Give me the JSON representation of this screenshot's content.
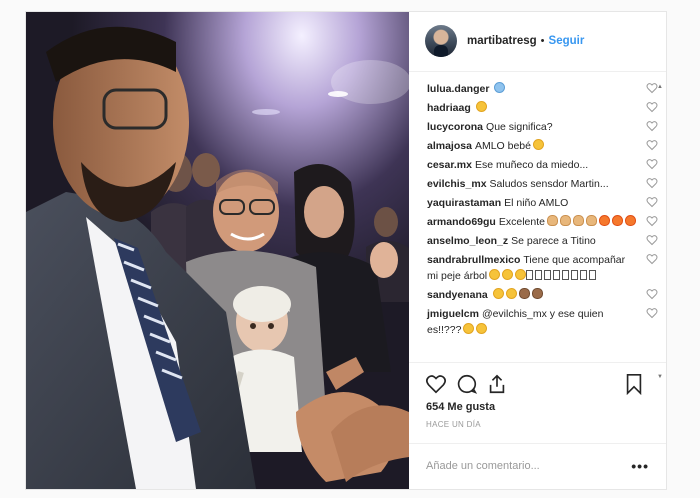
{
  "post": {
    "username": "martibatresg",
    "separator": "•",
    "follow_label": "Seguir",
    "likes": "654 Me gusta",
    "time_ago": "HACE UN DÍA",
    "comment_placeholder": "Añade un comentario...",
    "more_label": "•••"
  },
  "comments": [
    {
      "user": "lulua.danger",
      "text": "",
      "emoji": [
        "blue"
      ]
    },
    {
      "user": "hadriaag",
      "text": "",
      "emoji": [
        "yellow"
      ]
    },
    {
      "user": "lucycorona",
      "text": "Que significa?",
      "emoji": []
    },
    {
      "user": "almajosa",
      "text": "AMLO bebé",
      "emoji": [
        "yellow"
      ]
    },
    {
      "user": "cesar.mx",
      "text": "Ese muñeco da miedo...",
      "emoji": []
    },
    {
      "user": "evilchis_mx",
      "text": "Saludos sensdor Martin...",
      "emoji": []
    },
    {
      "user": "yaquirastaman",
      "text": "El niño AMLO",
      "emoji": []
    },
    {
      "user": "armando69gu",
      "text": "Excelente",
      "emoji": [
        "hand",
        "hand",
        "hand",
        "hand",
        "fire",
        "fire",
        "fire"
      ]
    },
    {
      "user": "anselmo_leon_z",
      "text": "Se parece a Titino",
      "emoji": []
    },
    {
      "user": "sandrabrullmexico",
      "text": "Tiene que acompañar mi peje árbol",
      "emoji": [
        "yellow",
        "yellow",
        "yellow",
        "box",
        "box",
        "box",
        "box",
        "box",
        "box",
        "box",
        "box"
      ]
    },
    {
      "user": "sandyenana",
      "text": "",
      "emoji": [
        "yellow",
        "yellow",
        "dark",
        "dark"
      ]
    },
    {
      "user": "jmiguelcm",
      "text": "@evilchis_mx y ese quien es!!???",
      "emoji": [
        "yellow",
        "yellow"
      ]
    }
  ],
  "icons": {
    "like": "heart-icon",
    "comment": "comment-icon",
    "share": "share-icon",
    "save": "bookmark-icon"
  },
  "colors": {
    "follow": "#3897f0",
    "text": "#262626",
    "muted": "#999999"
  }
}
